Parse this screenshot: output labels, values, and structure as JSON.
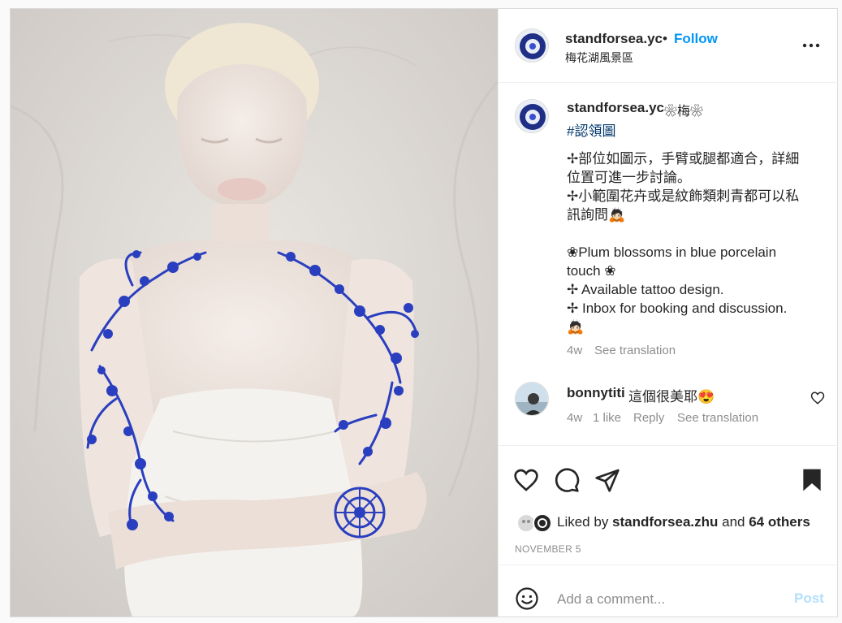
{
  "header": {
    "username": "standforsea.yc",
    "separator": "•",
    "follow_label": "Follow",
    "location": "梅花湖風景區",
    "more_icon": "more-horizontal-icon"
  },
  "caption": {
    "username": "standforsea.yc",
    "inline_emoji": "❀梅❀",
    "hashtag": "#認領圖",
    "lines": [
      "✢部位如圖示，手臂或腿都適合，詳細",
      "位置可進一步討論。",
      "✢小範圍花卉或是紋飾類刺青都可以私",
      "訊詢問🙇🏻",
      "",
      "❀Plum blossoms in blue porcelain",
      "touch ❀",
      "✢ Available tattoo design.",
      "✢ Inbox for booking and discussion.",
      "🙇🏻"
    ],
    "time": "4w",
    "see_translation": "See translation"
  },
  "comment": {
    "username": "bonnytiti",
    "text": "這個很美耶😍",
    "time": "4w",
    "likes": "1 like",
    "reply_label": "Reply",
    "see_translation": "See translation"
  },
  "actions": {
    "like_icon": "heart-outline-icon",
    "comment_icon": "comment-bubble-icon",
    "share_icon": "paper-plane-icon",
    "save_icon": "bookmark-filled-icon"
  },
  "likes": {
    "prefix": "Liked by ",
    "liked_user": "standforsea.zhu",
    "middle": " and ",
    "others": "64 others"
  },
  "date": "NOVEMBER 5",
  "add_comment": {
    "placeholder": "Add a comment...",
    "post_label": "Post",
    "emoji_icon": "smiley-icon"
  },
  "colors": {
    "accent_blue": "#0095f6",
    "post_disabled": "#b2dffc",
    "hashtag": "#00376b",
    "muted": "#8e8e8e",
    "porcelain_blue": "#2a3fbf"
  }
}
